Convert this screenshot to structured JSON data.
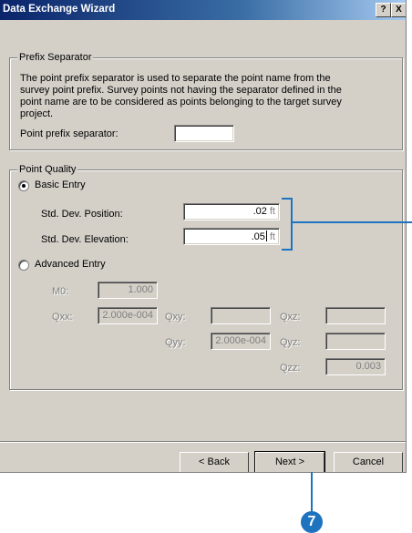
{
  "window": {
    "title": "Data Exchange Wizard",
    "help_btn": "?",
    "close_btn": "X"
  },
  "prefix": {
    "legend": "Prefix Separator",
    "desc_lines": [
      "The point prefix separator is used to separate the point name from the",
      "survey point prefix. Survey points not having the separator defined in the",
      "point name are to be considered as points belonging to the target survey",
      "project."
    ],
    "label": "Point prefix separator:",
    "value": ""
  },
  "quality": {
    "legend": "Point Quality",
    "basic_label": "Basic Entry",
    "basic_selected": true,
    "pos_label": "Std. Dev. Position:",
    "pos_value": ".02",
    "pos_unit": "ft",
    "elev_label": "Std. Dev. Elevation:",
    "elev_value": ".05",
    "elev_unit": "ft",
    "advanced_label": "Advanced Entry",
    "advanced_selected": false,
    "m0_label": "M0:",
    "m0_value": "1.000",
    "qxx_label": "Qxx:",
    "qxx_value": "2.000e-004",
    "qxy_label": "Qxy:",
    "qxy_value": "",
    "qxz_label": "Qxz:",
    "qxz_value": "",
    "qyy_label": "Qyy:",
    "qyy_value": "2.000e-004",
    "qyz_label": "Qyz:",
    "qyz_value": "",
    "qzz_label": "Qzz:",
    "qzz_value": "0.003"
  },
  "buttons": {
    "back": "< Back",
    "next": "Next >",
    "cancel": "Cancel"
  },
  "callout": {
    "number": "7",
    "color": "#1e73be"
  }
}
